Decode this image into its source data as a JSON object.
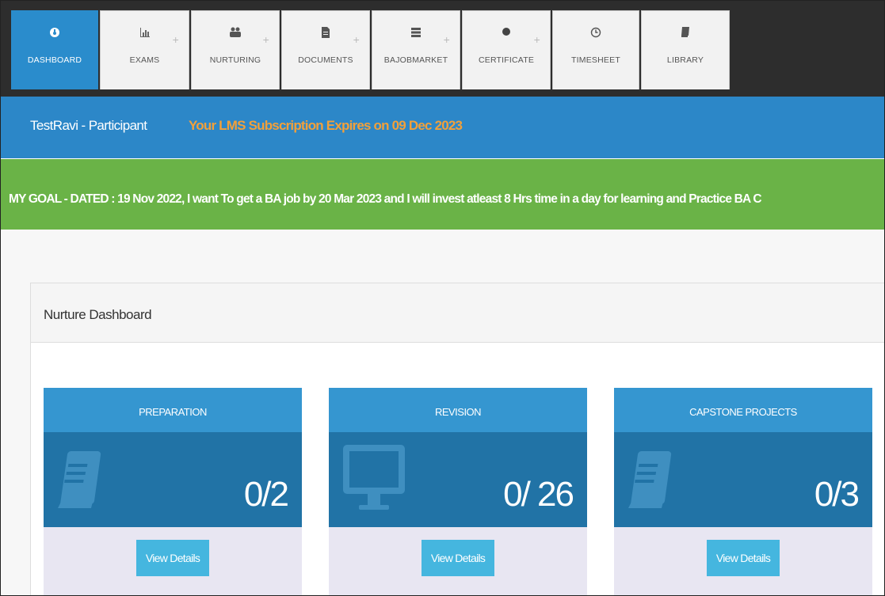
{
  "nav": {
    "tabs": [
      {
        "label": "DASHBOARD",
        "icon": "dashboard-icon",
        "active": true
      },
      {
        "label": "EXAMS",
        "icon": "bar-chart-icon"
      },
      {
        "label": "NURTURING",
        "icon": "users-icon"
      },
      {
        "label": "DOCUMENTS",
        "icon": "document-icon"
      },
      {
        "label": "BAJOBMARKET",
        "icon": "server-icon"
      },
      {
        "label": "CERTIFICATE",
        "icon": "certificate-icon"
      },
      {
        "label": "TIMESHEET",
        "icon": "clock-icon"
      },
      {
        "label": "LIBRARY",
        "icon": "book-icon"
      }
    ]
  },
  "header": {
    "user": "TestRavi - Participant",
    "expiry": "Your LMS Subscription Expires on 09 Dec 2023"
  },
  "goal": "MY GOAL - DATED : 19 Nov 2022, I want To get a BA job by 20 Mar 2023 and I will invest atleast 8 Hrs time in a day for learning and Practice BA C",
  "panel": {
    "title": "Nurture Dashboard"
  },
  "cards": [
    {
      "title": "PREPARATION",
      "count": "0/2",
      "icon": "book-icon",
      "button": "View Details"
    },
    {
      "title": "REVISION",
      "count": "0/ 26",
      "icon": "monitor-icon",
      "button": "View Details"
    },
    {
      "title": "CAPSTONE PROJECTS",
      "count": "0/3",
      "icon": "book-icon",
      "button": "View Details"
    }
  ],
  "colors": {
    "nav_active": "#2a8ccc",
    "header_bar": "#2c87c8",
    "expiry_text": "#f2a03a",
    "goal_bar": "#6ab347",
    "card_top": "#3596d0",
    "card_mid": "#2173a6",
    "button": "#45b6df"
  }
}
